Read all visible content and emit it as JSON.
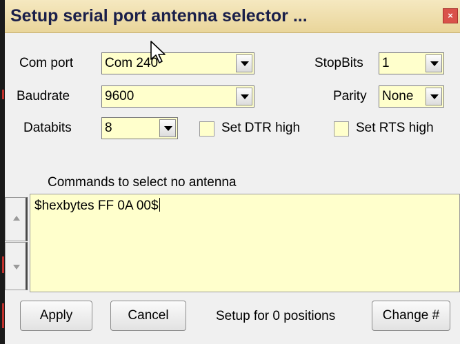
{
  "window": {
    "title": "Setup serial port antenna selector ...",
    "close_glyph": "×"
  },
  "serial": {
    "com_port": {
      "label": "Com port",
      "value": "Com 240"
    },
    "baudrate": {
      "label": "Baudrate",
      "value": "9600"
    },
    "databits": {
      "label": "Databits",
      "value": "8"
    },
    "stopbits": {
      "label": "StopBits",
      "value": "1"
    },
    "parity": {
      "label": "Parity",
      "value": "None"
    },
    "dtr": {
      "label": "Set DTR high",
      "checked": false
    },
    "rts": {
      "label": "Set RTS high",
      "checked": false
    }
  },
  "commands": {
    "label": "Commands to select no antenna",
    "text": "$hexbytes FF 0A 00$"
  },
  "footer": {
    "apply_label": "Apply",
    "cancel_label": "Cancel",
    "status": "Setup for 0 positions",
    "change_label": "Change #"
  },
  "colors": {
    "field_bg": "#ffffcc",
    "title_bg": "#efe0ad",
    "close_bg": "#d9524a"
  }
}
